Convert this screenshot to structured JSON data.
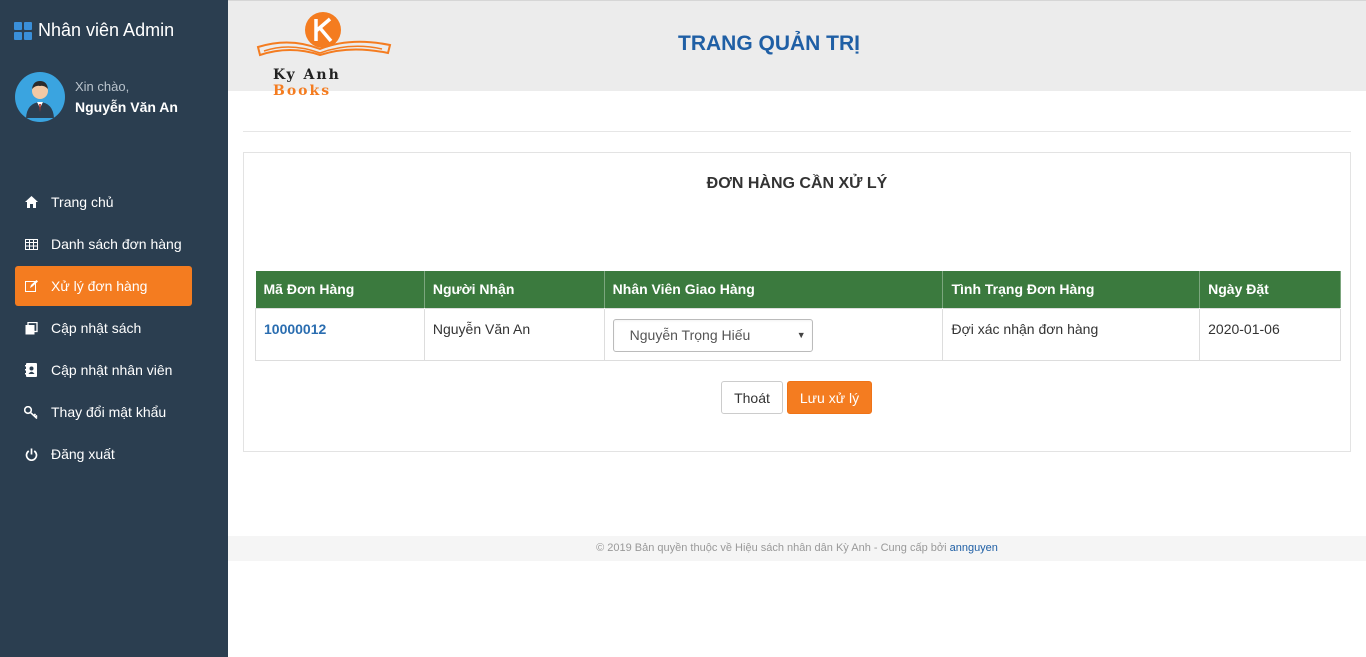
{
  "sidebar": {
    "brand": "Nhân viên Admin",
    "greeting": "Xin chào,",
    "user_name": "Nguyễn Văn An",
    "items": [
      {
        "label": "Trang chủ",
        "icon": "home-icon"
      },
      {
        "label": "Danh sách đơn hàng",
        "icon": "table-icon"
      },
      {
        "label": "Xử lý đơn hàng",
        "icon": "edit-icon",
        "active": true
      },
      {
        "label": "Cập nhật sách",
        "icon": "copy-icon"
      },
      {
        "label": "Cập nhật nhân viên",
        "icon": "contact-book-icon"
      },
      {
        "label": "Thay đổi mật khẩu",
        "icon": "key-icon"
      },
      {
        "label": "Đăng xuất",
        "icon": "power-icon"
      }
    ]
  },
  "header": {
    "logo_text_1": "Ky Anh",
    "logo_text_2": "Books",
    "title": "TRANG QUẢN TRỊ"
  },
  "main": {
    "panel_title": "ĐƠN HÀNG CẦN XỬ LÝ",
    "table": {
      "headers": [
        "Mã Đơn Hàng",
        "Người Nhận",
        "Nhân Viên Giao Hàng",
        "Tình Trạng Đơn Hàng",
        "Ngày Đặt"
      ],
      "rows": [
        {
          "order_id": "10000012",
          "recipient": "Nguyễn Văn An",
          "shipper": "Nguyễn Trọng Hiếu",
          "status": "Đợi xác nhận đơn hàng",
          "date": "2020-01-06"
        }
      ]
    },
    "exit_label": "Thoát",
    "save_label": "Lưu xử lý"
  },
  "footer": {
    "text": "© 2019 Bản quyền thuộc về Hiệu sách nhân dân Kỳ Anh - Cung cấp bởi",
    "link": "annguyen"
  },
  "colors": {
    "sidebar_bg": "#2b3e50",
    "accent": "#f47c20",
    "table_header": "#3b7a3e",
    "title_blue": "#1f5fa5"
  }
}
